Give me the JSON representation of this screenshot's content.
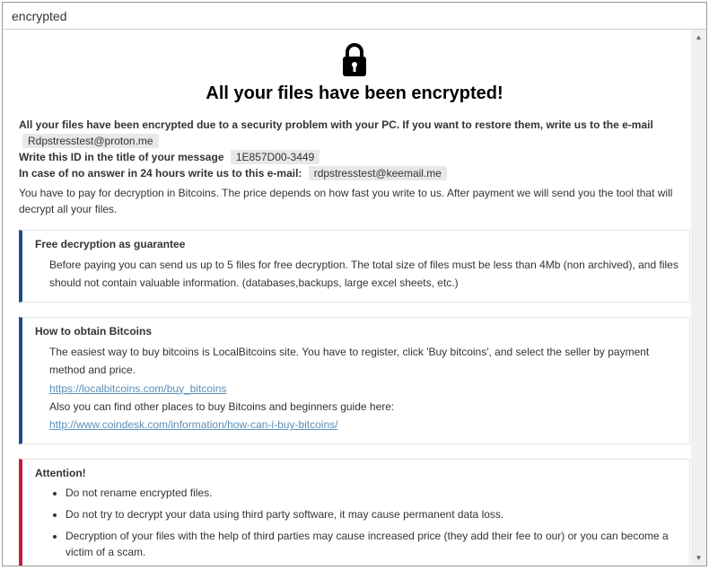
{
  "title": "encrypted",
  "icon": "lock-icon",
  "heading": "All your files have been encrypted!",
  "intro": {
    "line1": "All your files have been encrypted due to a security problem with your PC. If you want to restore them, write us to the e-mail",
    "email1": "Rdpstresstest@proton.me",
    "line2": "Write this ID in the title of your message",
    "id": "1E857D00-3449",
    "line3": "In case of no answer in 24 hours write us to this e-mail: ",
    "email2": "rdpstresstest@keemail.me",
    "payline": "You have to pay for decryption in Bitcoins. The price depends on how fast you write to us. After payment we will send you the tool that will decrypt all your files."
  },
  "box1": {
    "title": "Free decryption as guarantee",
    "text": "Before paying you can send us up to 5 files for free decryption. The total size of files must be less than 4Mb (non archived), and files should not contain valuable information. (databases,backups, large excel sheets, etc.)"
  },
  "box2": {
    "title": "How to obtain Bitcoins",
    "p1": "The easiest way to buy bitcoins is LocalBitcoins site. You have to register, click 'Buy bitcoins', and select the seller by payment method and price.",
    "link1": "https://localbitcoins.com/buy_bitcoins",
    "p2": "Also you can find other places to buy Bitcoins and beginners guide here:",
    "link2": "http://www.coindesk.com/information/how-can-i-buy-bitcoins/"
  },
  "box3": {
    "title": "Attention!",
    "items": [
      "Do not rename encrypted files.",
      "Do not try to decrypt your data using third party software, it may cause permanent data loss.",
      "Decryption of your files with the help of third parties may cause increased price (they add their fee to our) or you can become a victim of a scam."
    ]
  }
}
